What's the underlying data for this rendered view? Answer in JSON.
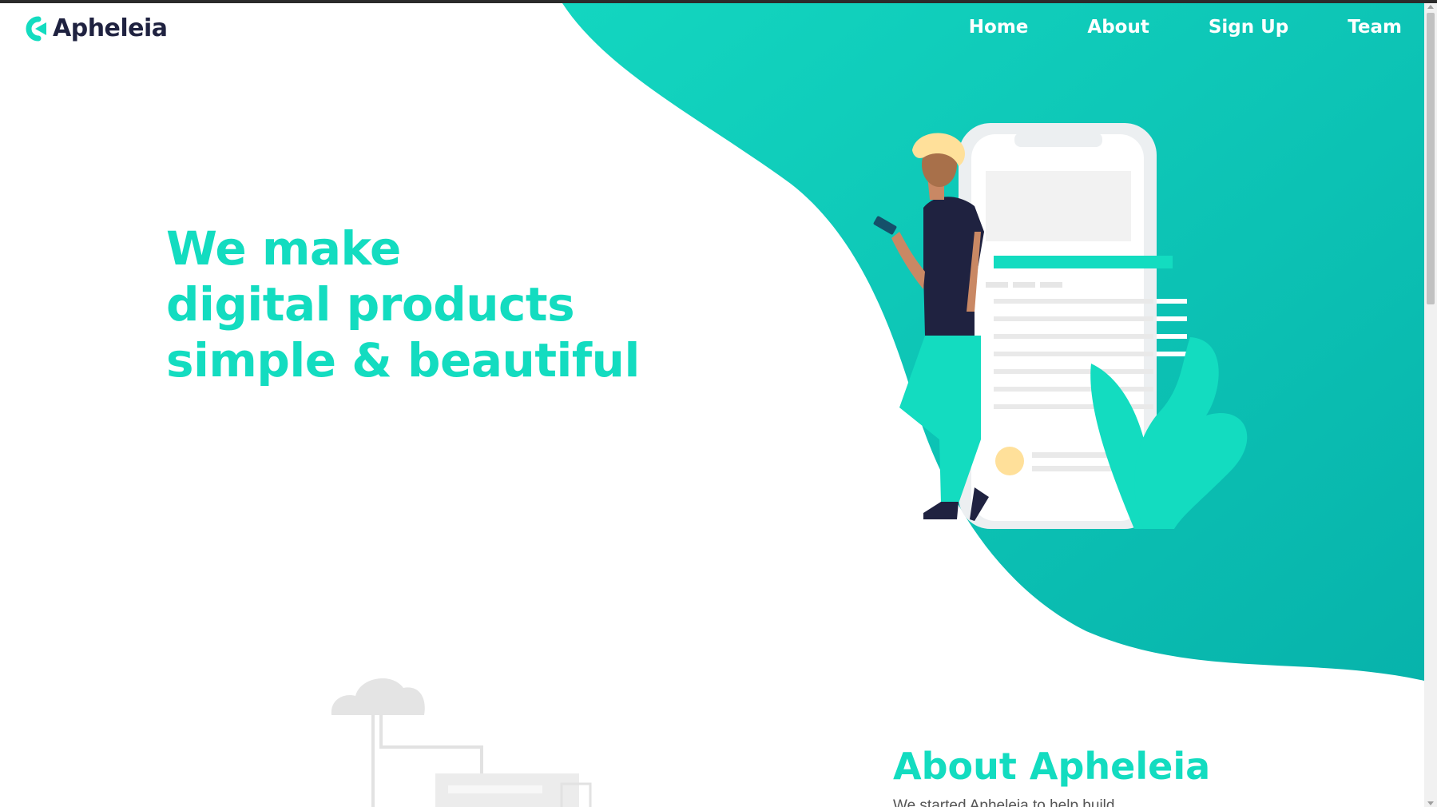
{
  "brand": {
    "name": "Apheleia",
    "accent": "#13dcc0",
    "dark": "#1f2240"
  },
  "nav": {
    "items": [
      {
        "label": "Home"
      },
      {
        "label": "About"
      },
      {
        "label": "Sign Up"
      },
      {
        "label": "Team"
      }
    ]
  },
  "hero": {
    "lines": [
      "We make",
      "digital products",
      "simple & beautiful"
    ]
  },
  "about": {
    "title": "About Apheleia",
    "text_fragment": "We started Apheleia to help build"
  },
  "icons": {
    "logo": "apheleia-logo-icon",
    "hero_illustration": "person-with-phone-illustration",
    "cloud_illustration": "cloud-server-illustration"
  }
}
